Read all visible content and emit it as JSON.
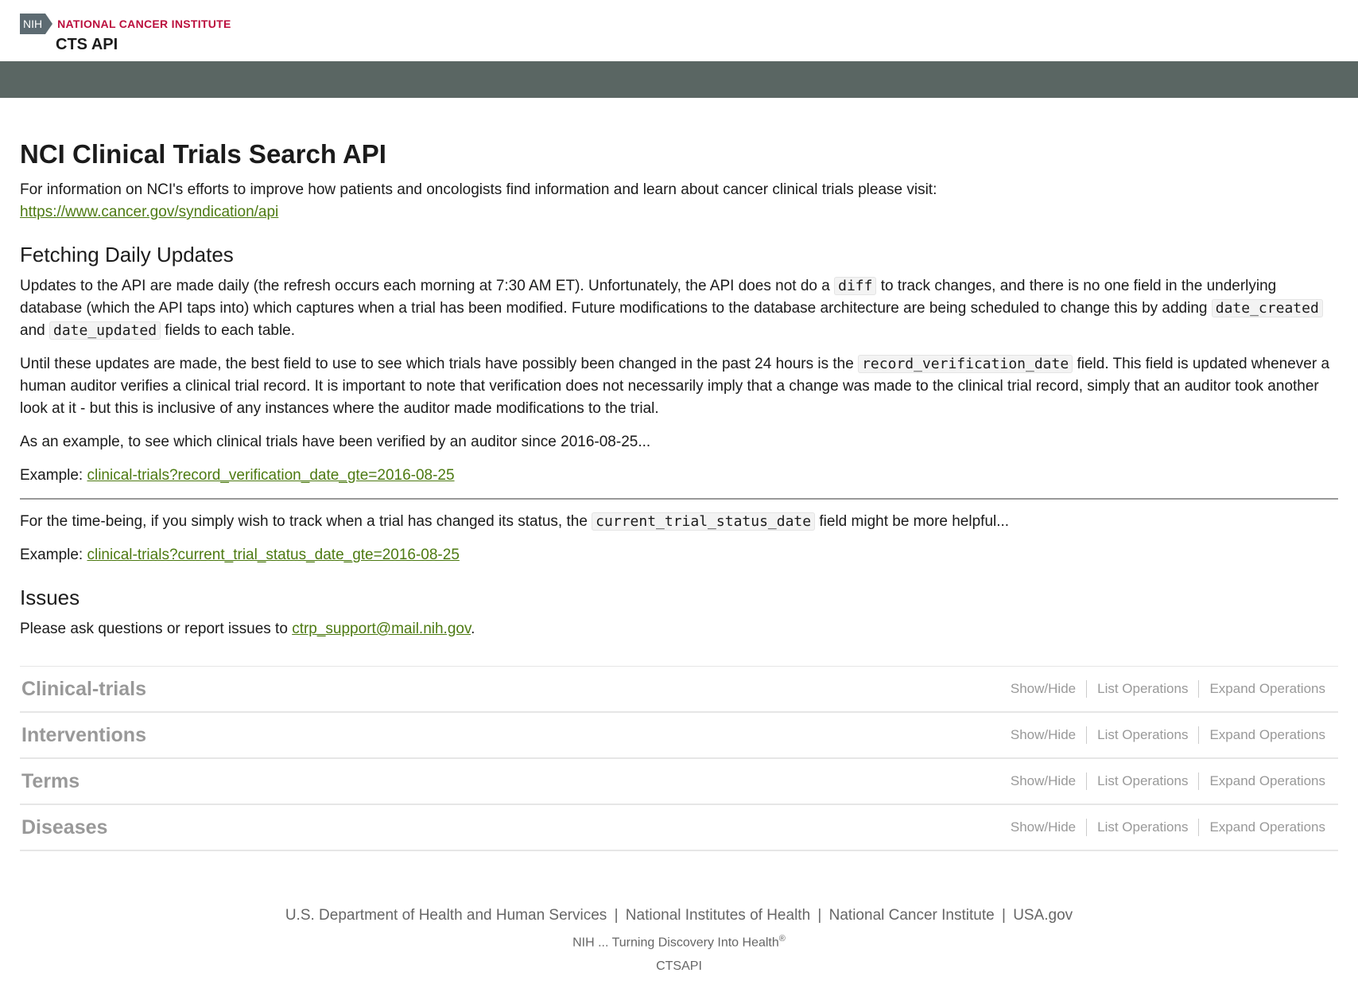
{
  "header": {
    "nih_label": "NIH",
    "org_name": "NATIONAL CANCER INSTITUTE",
    "app_name": "CTS API",
    "colors": {
      "brand_red": "#bb0e3d",
      "nav_bar": "#5a6663",
      "link_green": "#4d7a12"
    }
  },
  "main": {
    "title": "NCI Clinical Trials Search API",
    "intro_text": "For information on NCI's efforts to improve how patients and oncologists find information and learn about cancer clinical trials please visit:",
    "intro_link": "https://www.cancer.gov/syndication/api",
    "daily_updates": {
      "heading": "Fetching Daily Updates",
      "p1_part1": "Updates to the API are made daily (the refresh occurs each morning at 7:30 AM ET). Unfortunately, the API does not do a ",
      "p1_code1": "diff",
      "p1_part2": " to track changes, and there is no one field in the underlying database (which the API taps into) which captures when a trial has been modified. Future modifications to the database architecture are being scheduled to change this by adding ",
      "p1_code2": "date_created",
      "p1_part3": " and ",
      "p1_code3": "date_updated",
      "p1_part4": " fields to each table.",
      "p2_part1": "Until these updates are made, the best field to use to see which trials have possibly been changed in the past 24 hours is the ",
      "p2_code": "record_verification_date",
      "p2_part2": " field. This field is updated whenever a human auditor verifies a clinical trial record. It is important to note that verification does not necessarily imply that a change was made to the clinical trial record, simply that an auditor took another look at it - but this is inclusive of any instances where the auditor made modifications to the trial.",
      "p3": "As an example, to see which clinical trials have been verified by an auditor since 2016-08-25...",
      "example_label": "Example: ",
      "example1_link": "clinical-trials?record_verification_date_gte=2016-08-25",
      "p4_part1": "For the time-being, if you simply wish to track when a trial has changed its status, the ",
      "p4_code": "current_trial_status_date",
      "p4_part2": " field might be more helpful...",
      "example2_link": "clinical-trials?current_trial_status_date_gte=2016-08-25"
    },
    "issues": {
      "heading": "Issues",
      "text": "Please ask questions or report issues to ",
      "email": "ctrp_support@mail.nih.gov",
      "period": "."
    }
  },
  "resources": {
    "items": [
      {
        "name": "Clinical-trials"
      },
      {
        "name": "Interventions"
      },
      {
        "name": "Terms"
      },
      {
        "name": "Diseases"
      }
    ],
    "ops": {
      "show_hide": "Show/Hide",
      "list": "List Operations",
      "expand": "Expand Operations"
    }
  },
  "footer": {
    "links": [
      "U.S. Department of Health and Human Services",
      "National Institutes of Health",
      "National Cancer Institute",
      "USA.gov"
    ],
    "separator": "|",
    "tagline": "NIH ... Turning Discovery Into Health",
    "tagline_mark": "®",
    "app_id": "CTSAPI"
  }
}
